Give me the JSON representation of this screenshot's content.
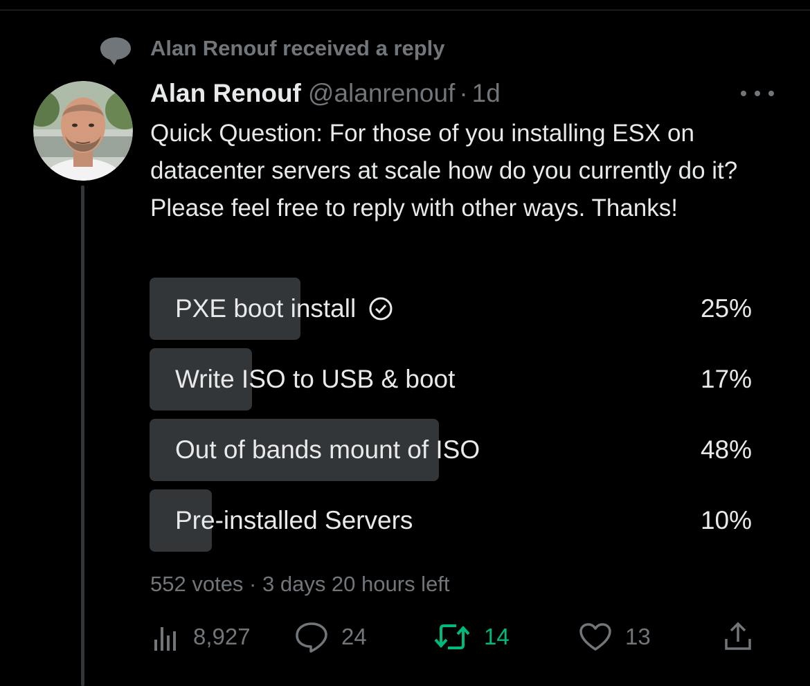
{
  "context": {
    "text": "Alan Renouf received a reply",
    "icon": "speech-bubble-icon"
  },
  "tweet": {
    "author_name": "Alan Renouf",
    "handle": "@alanrenouf",
    "separator": "·",
    "time": "1d",
    "text": "Quick Question: For those of you installing ESX on datacenter servers at scale how do you currently do it? Please feel free to reply with other ways. Thanks!"
  },
  "poll": {
    "options": [
      {
        "label": "PXE boot install",
        "percent_label": "25%",
        "percent": 25,
        "voted": true
      },
      {
        "label": "Write ISO to USB & boot",
        "percent_label": "17%",
        "percent": 17,
        "voted": false
      },
      {
        "label": "Out of bands mount of ISO",
        "percent_label": "48%",
        "percent": 48,
        "voted": false
      },
      {
        "label": "Pre-installed Servers",
        "percent_label": "10%",
        "percent": 10,
        "voted": false
      }
    ],
    "meta": "552 votes · 3 days 20 hours left"
  },
  "actions": {
    "views": "8,927",
    "replies": "24",
    "retweets": "14",
    "likes": "13"
  },
  "colors": {
    "background": "#000000",
    "primary_text": "#e7e9ea",
    "secondary_text": "#71767b",
    "poll_bar": "#333639",
    "retweet_active": "#00ba7c"
  }
}
